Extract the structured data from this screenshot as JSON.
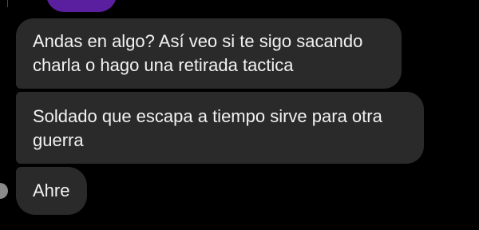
{
  "chat": {
    "messages": [
      {
        "line1": "Andas en algo? Así veo si te sigo sacando",
        "line2": "charla o hago una retirada tactica"
      },
      {
        "line1": "Soldado que escapa a tiempo sirve para otra",
        "line2": "guerra"
      },
      {
        "line1": "Ahre"
      }
    ]
  },
  "colors": {
    "background": "#000000",
    "bubble": "#2a2a2a",
    "text": "#f2f2f2",
    "previous_bubble_accent": "#5a1f9e"
  }
}
